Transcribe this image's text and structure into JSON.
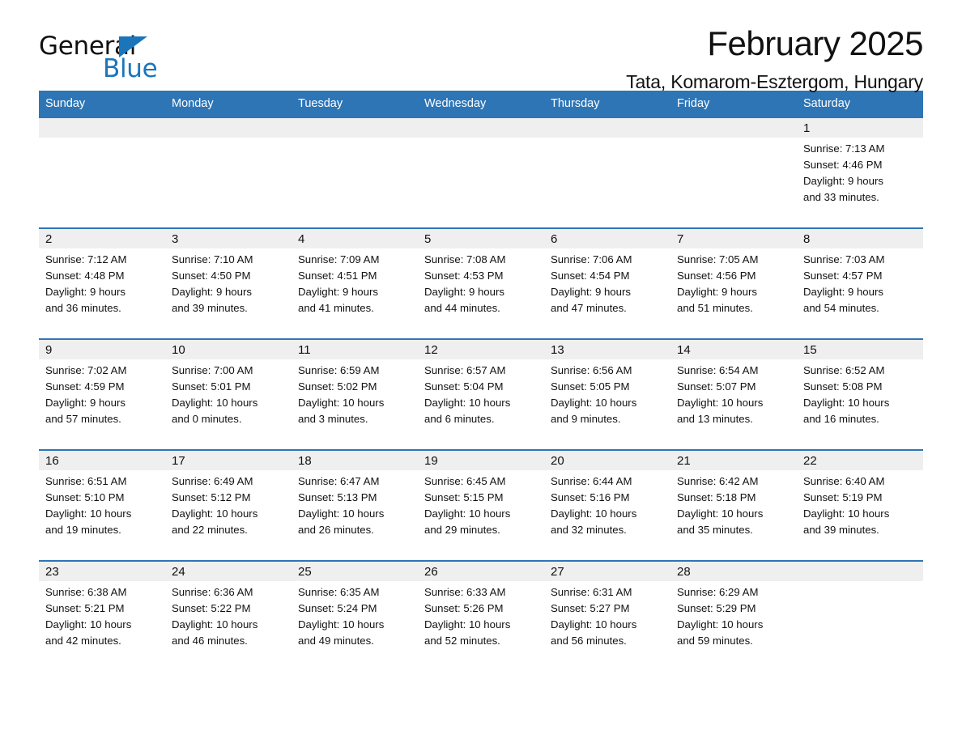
{
  "brand": {
    "name_part1": "General",
    "name_part2": "Blue",
    "triangle_color": "#1b75bb"
  },
  "header": {
    "title": "February 2025",
    "subtitle": "Tata, Komarom-Esztergom, Hungary"
  },
  "colors": {
    "header_blue": "#2e75b6",
    "band_gray": "#efefef",
    "text": "#111111"
  },
  "calendar": {
    "weekday_headers": [
      "Sunday",
      "Monday",
      "Tuesday",
      "Wednesday",
      "Thursday",
      "Friday",
      "Saturday"
    ],
    "weeks": [
      [
        {
          "day": "",
          "empty": true
        },
        {
          "day": "",
          "empty": true
        },
        {
          "day": "",
          "empty": true
        },
        {
          "day": "",
          "empty": true
        },
        {
          "day": "",
          "empty": true
        },
        {
          "day": "",
          "empty": true
        },
        {
          "day": "1",
          "sunrise": "Sunrise: 7:13 AM",
          "sunset": "Sunset: 4:46 PM",
          "daylight_l1": "Daylight: 9 hours",
          "daylight_l2": "and 33 minutes."
        }
      ],
      [
        {
          "day": "2",
          "sunrise": "Sunrise: 7:12 AM",
          "sunset": "Sunset: 4:48 PM",
          "daylight_l1": "Daylight: 9 hours",
          "daylight_l2": "and 36 minutes."
        },
        {
          "day": "3",
          "sunrise": "Sunrise: 7:10 AM",
          "sunset": "Sunset: 4:50 PM",
          "daylight_l1": "Daylight: 9 hours",
          "daylight_l2": "and 39 minutes."
        },
        {
          "day": "4",
          "sunrise": "Sunrise: 7:09 AM",
          "sunset": "Sunset: 4:51 PM",
          "daylight_l1": "Daylight: 9 hours",
          "daylight_l2": "and 41 minutes."
        },
        {
          "day": "5",
          "sunrise": "Sunrise: 7:08 AM",
          "sunset": "Sunset: 4:53 PM",
          "daylight_l1": "Daylight: 9 hours",
          "daylight_l2": "and 44 minutes."
        },
        {
          "day": "6",
          "sunrise": "Sunrise: 7:06 AM",
          "sunset": "Sunset: 4:54 PM",
          "daylight_l1": "Daylight: 9 hours",
          "daylight_l2": "and 47 minutes."
        },
        {
          "day": "7",
          "sunrise": "Sunrise: 7:05 AM",
          "sunset": "Sunset: 4:56 PM",
          "daylight_l1": "Daylight: 9 hours",
          "daylight_l2": "and 51 minutes."
        },
        {
          "day": "8",
          "sunrise": "Sunrise: 7:03 AM",
          "sunset": "Sunset: 4:57 PM",
          "daylight_l1": "Daylight: 9 hours",
          "daylight_l2": "and 54 minutes."
        }
      ],
      [
        {
          "day": "9",
          "sunrise": "Sunrise: 7:02 AM",
          "sunset": "Sunset: 4:59 PM",
          "daylight_l1": "Daylight: 9 hours",
          "daylight_l2": "and 57 minutes."
        },
        {
          "day": "10",
          "sunrise": "Sunrise: 7:00 AM",
          "sunset": "Sunset: 5:01 PM",
          "daylight_l1": "Daylight: 10 hours",
          "daylight_l2": "and 0 minutes."
        },
        {
          "day": "11",
          "sunrise": "Sunrise: 6:59 AM",
          "sunset": "Sunset: 5:02 PM",
          "daylight_l1": "Daylight: 10 hours",
          "daylight_l2": "and 3 minutes."
        },
        {
          "day": "12",
          "sunrise": "Sunrise: 6:57 AM",
          "sunset": "Sunset: 5:04 PM",
          "daylight_l1": "Daylight: 10 hours",
          "daylight_l2": "and 6 minutes."
        },
        {
          "day": "13",
          "sunrise": "Sunrise: 6:56 AM",
          "sunset": "Sunset: 5:05 PM",
          "daylight_l1": "Daylight: 10 hours",
          "daylight_l2": "and 9 minutes."
        },
        {
          "day": "14",
          "sunrise": "Sunrise: 6:54 AM",
          "sunset": "Sunset: 5:07 PM",
          "daylight_l1": "Daylight: 10 hours",
          "daylight_l2": "and 13 minutes."
        },
        {
          "day": "15",
          "sunrise": "Sunrise: 6:52 AM",
          "sunset": "Sunset: 5:08 PM",
          "daylight_l1": "Daylight: 10 hours",
          "daylight_l2": "and 16 minutes."
        }
      ],
      [
        {
          "day": "16",
          "sunrise": "Sunrise: 6:51 AM",
          "sunset": "Sunset: 5:10 PM",
          "daylight_l1": "Daylight: 10 hours",
          "daylight_l2": "and 19 minutes."
        },
        {
          "day": "17",
          "sunrise": "Sunrise: 6:49 AM",
          "sunset": "Sunset: 5:12 PM",
          "daylight_l1": "Daylight: 10 hours",
          "daylight_l2": "and 22 minutes."
        },
        {
          "day": "18",
          "sunrise": "Sunrise: 6:47 AM",
          "sunset": "Sunset: 5:13 PM",
          "daylight_l1": "Daylight: 10 hours",
          "daylight_l2": "and 26 minutes."
        },
        {
          "day": "19",
          "sunrise": "Sunrise: 6:45 AM",
          "sunset": "Sunset: 5:15 PM",
          "daylight_l1": "Daylight: 10 hours",
          "daylight_l2": "and 29 minutes."
        },
        {
          "day": "20",
          "sunrise": "Sunrise: 6:44 AM",
          "sunset": "Sunset: 5:16 PM",
          "daylight_l1": "Daylight: 10 hours",
          "daylight_l2": "and 32 minutes."
        },
        {
          "day": "21",
          "sunrise": "Sunrise: 6:42 AM",
          "sunset": "Sunset: 5:18 PM",
          "daylight_l1": "Daylight: 10 hours",
          "daylight_l2": "and 35 minutes."
        },
        {
          "day": "22",
          "sunrise": "Sunrise: 6:40 AM",
          "sunset": "Sunset: 5:19 PM",
          "daylight_l1": "Daylight: 10 hours",
          "daylight_l2": "and 39 minutes."
        }
      ],
      [
        {
          "day": "23",
          "sunrise": "Sunrise: 6:38 AM",
          "sunset": "Sunset: 5:21 PM",
          "daylight_l1": "Daylight: 10 hours",
          "daylight_l2": "and 42 minutes."
        },
        {
          "day": "24",
          "sunrise": "Sunrise: 6:36 AM",
          "sunset": "Sunset: 5:22 PM",
          "daylight_l1": "Daylight: 10 hours",
          "daylight_l2": "and 46 minutes."
        },
        {
          "day": "25",
          "sunrise": "Sunrise: 6:35 AM",
          "sunset": "Sunset: 5:24 PM",
          "daylight_l1": "Daylight: 10 hours",
          "daylight_l2": "and 49 minutes."
        },
        {
          "day": "26",
          "sunrise": "Sunrise: 6:33 AM",
          "sunset": "Sunset: 5:26 PM",
          "daylight_l1": "Daylight: 10 hours",
          "daylight_l2": "and 52 minutes."
        },
        {
          "day": "27",
          "sunrise": "Sunrise: 6:31 AM",
          "sunset": "Sunset: 5:27 PM",
          "daylight_l1": "Daylight: 10 hours",
          "daylight_l2": "and 56 minutes."
        },
        {
          "day": "28",
          "sunrise": "Sunrise: 6:29 AM",
          "sunset": "Sunset: 5:29 PM",
          "daylight_l1": "Daylight: 10 hours",
          "daylight_l2": "and 59 minutes."
        },
        {
          "day": "",
          "empty": true
        }
      ]
    ]
  }
}
